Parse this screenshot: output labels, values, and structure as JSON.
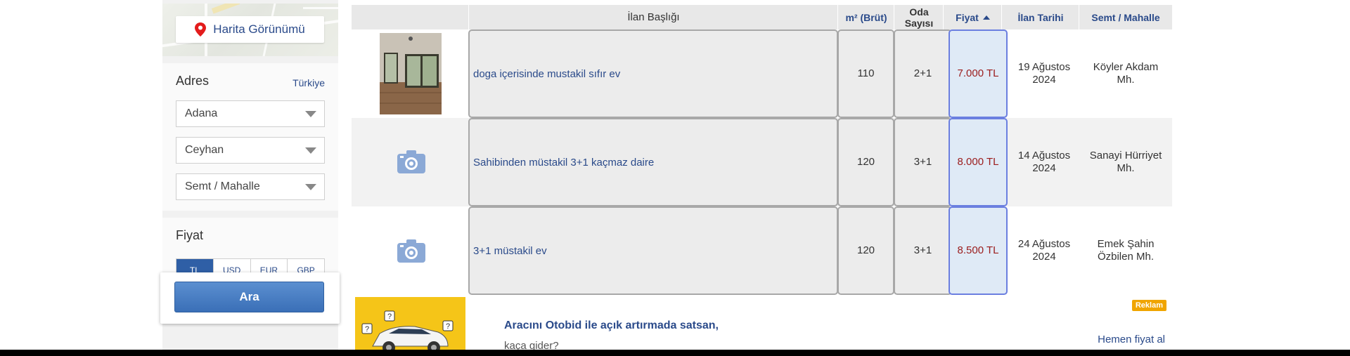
{
  "sidebar": {
    "map_button_label": "Harita Görünümü",
    "address": {
      "title": "Adres",
      "country_link": "Türkiye",
      "city": "Adana",
      "district": "Ceyhan",
      "neighborhood": "Semt / Mahalle"
    },
    "price": {
      "title": "Fiyat",
      "currencies": [
        "TL",
        "USD",
        "EUR",
        "GBP"
      ]
    },
    "search_button_label": "Ara"
  },
  "table": {
    "headers": {
      "title": "İlan Başlığı",
      "area": "m² (Brüt)",
      "rooms": "Oda Sayısı",
      "price": "Fiyat",
      "date": "İlan Tarihi",
      "location": "Semt / Mahalle"
    },
    "rows": [
      {
        "title": "doga içerisinde mustakil sıfır ev",
        "area": "110",
        "rooms": "2+1",
        "price": "7.000 TL",
        "date": "19 Ağustos 2024",
        "location": "Köyler Akdam Mh.",
        "has_photo": true
      },
      {
        "title": "Sahibinden müstakil 3+1 kaçmaz daire",
        "area": "120",
        "rooms": "3+1",
        "price": "8.000 TL",
        "date": "14 Ağustos 2024",
        "location": "Sanayi Hürriyet Mh.",
        "has_photo": false
      },
      {
        "title": "3+1 müstakil ev",
        "area": "120",
        "rooms": "3+1",
        "price": "8.500 TL",
        "date": "24 Ağustos 2024",
        "location": "Emek Şahin Özbilen Mh.",
        "has_photo": false
      }
    ]
  },
  "ad": {
    "title": "Aracını Otobid ile açık artırmada satsan,",
    "subtitle": "kaça gider?",
    "badge": "Reklam",
    "link": "Hemen fiyat al"
  },
  "colors": {
    "brand_blue": "#2a4a8a",
    "price_red": "#9b1c1c",
    "selected_border": "#6b7fe0",
    "ad_badge": "#f0a500"
  }
}
